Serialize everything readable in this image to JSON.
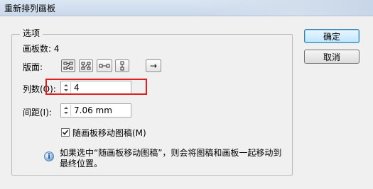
{
  "window": {
    "title": "重新排列画板"
  },
  "options_group": {
    "label": "选项",
    "artboard_count": "画板数: 4",
    "layout_label": "版面:",
    "layout_buttons": [
      "grid-by-row-icon",
      "grid-by-column-icon",
      "arrange-by-row-icon",
      "arrange-by-column-icon"
    ],
    "direction_arrow": "→",
    "columns_label": "列数(O):",
    "columns_value": "4",
    "spacing_label": "间距(I):",
    "spacing_value": "7.06 mm",
    "move_artwork_label": "随画板移动图稿(M)",
    "move_artwork_checked": true,
    "info_line1": "如果选中“随画板移动图稿”，则会将图稿和画板一起移动到",
    "info_line2": "最终位置。"
  },
  "buttons": {
    "ok": "确定",
    "cancel": "取消"
  },
  "colors": {
    "highlight": "#e02020",
    "titlebar": "#c9d8ea"
  }
}
